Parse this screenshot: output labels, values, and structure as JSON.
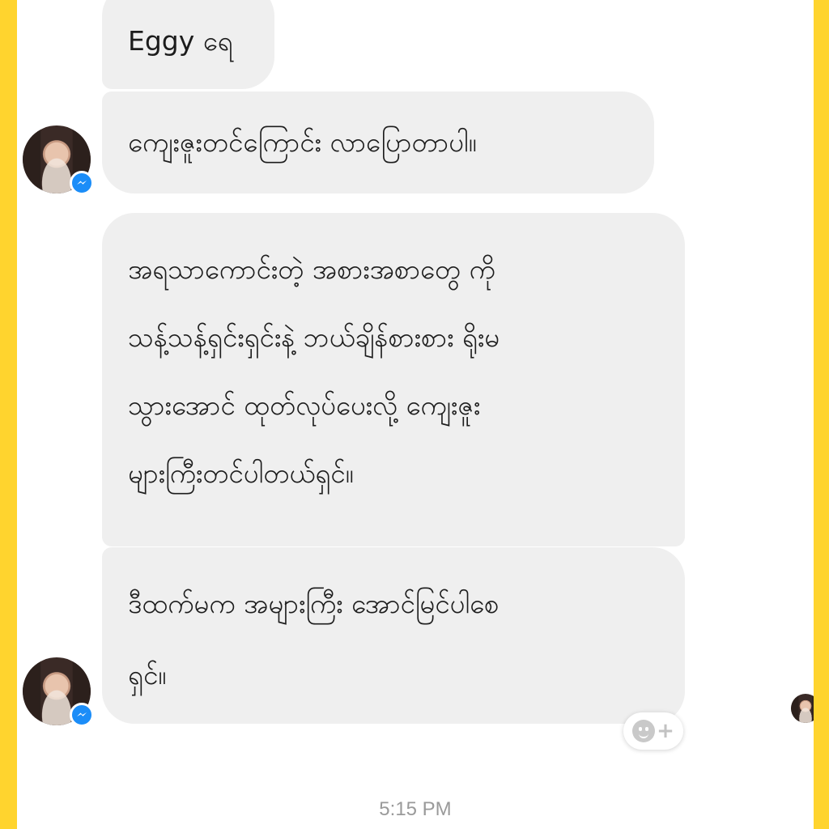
{
  "messages": [
    {
      "text": "Eggy ရေ"
    },
    {
      "text": "ကျေးဇူးတင်ကြောင်း လာပြောတာပါ။"
    },
    {
      "lines": [
        "အရသာကောင်းတဲ့ အစားအစာတွေ ကို",
        "သန့်သန့်ရှင်းရှင်းနဲ့ ဘယ်ချိန်စားစား ရိုးမ",
        "သွားအောင် ထုတ်လုပ်ပေးလို့ ကျေးဇူး",
        "များကြီးတင်ပါတယ်ရှင်။"
      ]
    },
    {
      "lines": [
        "ဒီထက်မက အများကြီး အောင်မြင်ပါစေ",
        "ရှင်။"
      ]
    }
  ],
  "timestamp": "5:15 PM",
  "icons": {
    "avatar": "profile-photo",
    "badge": "messenger-icon",
    "reaction": "add-reaction-icon"
  },
  "colors": {
    "frame": "#ffd42e",
    "bubble": "#efefef",
    "messenger_blue": "#1b8df8",
    "timestamp": "#9a9a9a"
  }
}
